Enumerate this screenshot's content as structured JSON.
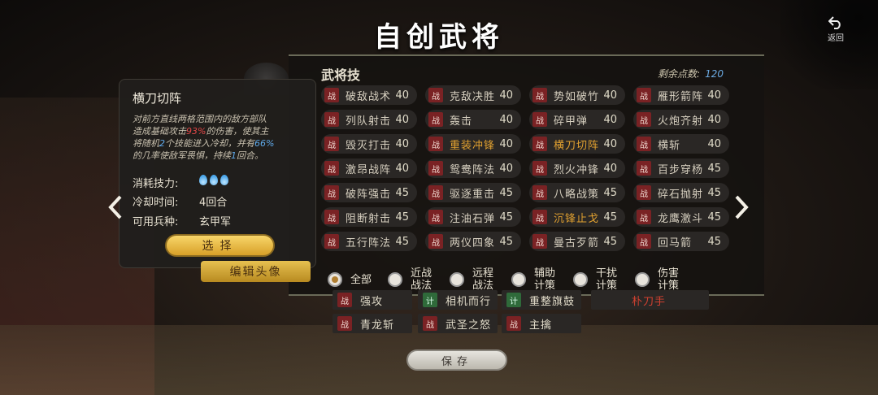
{
  "header": {
    "title": "自创武将",
    "back_label": "返回"
  },
  "panel": {
    "title": "武将技",
    "points_label": "剩余点数:",
    "points_value": "120",
    "badge_war": "战",
    "badge_plan": "计",
    "skills": [
      {
        "name": "破敌战术",
        "cost": "40",
        "orange": false
      },
      {
        "name": "克敌决胜",
        "cost": "40",
        "orange": false
      },
      {
        "name": "势如破竹",
        "cost": "40",
        "orange": false
      },
      {
        "name": "雁形箭阵",
        "cost": "40",
        "orange": false
      },
      {
        "name": "列队射击",
        "cost": "40",
        "orange": false
      },
      {
        "name": "轰击",
        "cost": "40",
        "orange": false
      },
      {
        "name": "碎甲弹",
        "cost": "40",
        "orange": false
      },
      {
        "name": "火炮齐射",
        "cost": "40",
        "orange": false
      },
      {
        "name": "毁灭打击",
        "cost": "40",
        "orange": false
      },
      {
        "name": "重装冲锋",
        "cost": "40",
        "orange": true
      },
      {
        "name": "横刀切阵",
        "cost": "40",
        "orange": true
      },
      {
        "name": "横斩",
        "cost": "40",
        "orange": false
      },
      {
        "name": "激昂战阵",
        "cost": "40",
        "orange": false
      },
      {
        "name": "鸳鸯阵法",
        "cost": "40",
        "orange": false
      },
      {
        "name": "烈火冲锋",
        "cost": "40",
        "orange": false
      },
      {
        "name": "百步穿杨",
        "cost": "45",
        "orange": false
      },
      {
        "name": "破阵强击",
        "cost": "45",
        "orange": false
      },
      {
        "name": "驱逐重击",
        "cost": "45",
        "orange": false
      },
      {
        "name": "八略战策",
        "cost": "45",
        "orange": false
      },
      {
        "name": "碎石抛射",
        "cost": "45",
        "orange": false
      },
      {
        "name": "阻断射击",
        "cost": "45",
        "orange": false
      },
      {
        "name": "注油石弹",
        "cost": "45",
        "orange": false
      },
      {
        "name": "沉锋止戈",
        "cost": "45",
        "orange": true
      },
      {
        "name": "龙鹰激斗",
        "cost": "45",
        "orange": false
      },
      {
        "name": "五行阵法",
        "cost": "45",
        "orange": false
      },
      {
        "name": "两仪四象",
        "cost": "45",
        "orange": false
      },
      {
        "name": "曼古歹箭",
        "cost": "45",
        "orange": false
      },
      {
        "name": "回马箭",
        "cost": "45",
        "orange": false
      }
    ],
    "filters": [
      {
        "label": "全部",
        "selected": true
      },
      {
        "label": "近战战法",
        "selected": false
      },
      {
        "label": "远程战法",
        "selected": false
      },
      {
        "label": "辅助计策",
        "selected": false
      },
      {
        "label": "干扰计策",
        "selected": false
      },
      {
        "label": "伤害计策",
        "selected": false
      }
    ]
  },
  "tooltip": {
    "title": "横刀切阵",
    "desc_1": "对前方直线两格范围内的敌方部队",
    "desc_2a": "造成基础攻击",
    "desc_2b": "93%",
    "desc_2c": "的伤害，使其主",
    "desc_3a": "将随机",
    "desc_3b": "2",
    "desc_3c": "个技能进入冷却，并有",
    "desc_3d": "66%",
    "desc_4a": "的几率使敌军畏惧，持续",
    "desc_4b": "1",
    "desc_4c": "回合。",
    "cost_label": "消耗技力:",
    "cooldown_label": "冷却时间:",
    "cooldown_value": "4回合",
    "troop_label": "可用兵种:",
    "troop_value": "玄甲军",
    "select_label": "选择",
    "edit_avatar_label": "编辑头像"
  },
  "loadout": [
    {
      "badge": "战",
      "name": "强攻",
      "type": "war"
    },
    {
      "badge": "计",
      "name": "相机而行",
      "type": "plan"
    },
    {
      "badge": "计",
      "name": "重整旗鼓",
      "type": "plan"
    },
    {
      "badge": "",
      "name": "朴刀手",
      "type": "red"
    },
    {
      "badge": "战",
      "name": "青龙斩",
      "type": "war"
    },
    {
      "badge": "战",
      "name": "武圣之怒",
      "type": "war"
    },
    {
      "badge": "战",
      "name": "主擒",
      "type": "war"
    }
  ],
  "footer": {
    "save_label": "保存"
  },
  "colors": {
    "accent_gold": "#e0a030",
    "highlight_red": "#e24848",
    "highlight_blue": "#5fa8e8",
    "war_badge": "#7a2224",
    "plan_badge": "#2f6a3a"
  }
}
